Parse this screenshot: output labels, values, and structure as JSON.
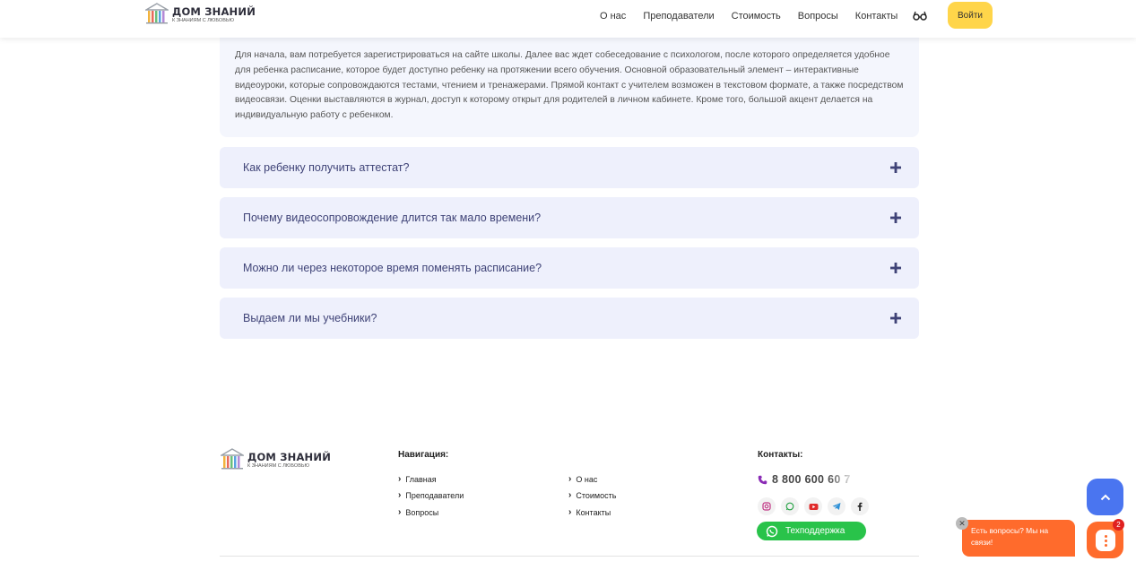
{
  "header": {
    "logo_title": "ДОМ ЗНАНИЙ",
    "logo_subtitle": "К ЗНАНИЯМ С ЛЮБОВЬЮ",
    "nav": [
      "О нас",
      "Преподаватели",
      "Стоимость",
      "Вопросы",
      "Контакты"
    ],
    "login_label": "Войти"
  },
  "faq": {
    "open_answer": "Для начала, вам потребуется зарегистрироваться на сайте школы. Далее вас ждет собеседование с психологом, после которого определяется удобное для ребенка расписание, которое будет доступно ребенку на протяжении всего обучения. Основной образовательный элемент – интерактивные видеоуроки, которые сопровождаются тестами, чтением и тренажерами. Прямой контакт с учителем возможен в текстовом формате, а также посредством видеосвязи. Оценки выставляются в журнал, доступ к которому открыт для родителей в личном кабинете. Кроме того, большой акцент делается на индивидуальную работу с ребенком.",
    "questions": [
      "Как ребенку получить аттестат?",
      "Почему видеосопровождение длится так мало времени?",
      "Можно ли через некоторое время поменять расписание?",
      "Выдаем ли мы учебники?"
    ]
  },
  "footer": {
    "logo_title": "ДОМ ЗНАНИЙ",
    "logo_subtitle": "К ЗНАНИЯМ С ЛЮБОВЬЮ",
    "nav_heading": "Навигация:",
    "nav_col1": [
      "Главная",
      "Преподаватели",
      "Вопросы"
    ],
    "nav_col2": [
      "О нас",
      "Стоимость",
      "Контакты"
    ],
    "contacts_heading": "Контакты:",
    "phone": "8 800 600 60 7",
    "socials": [
      "instagram-icon",
      "whatsapp-icon",
      "youtube-icon",
      "telegram-icon",
      "facebook-icon"
    ],
    "support_label": "Техподдержка"
  },
  "widgets": {
    "chat_prompt": "Есть вопросы? Мы на связи!",
    "chat_badge": "2",
    "close_glyph": "✕"
  },
  "colors": {
    "accent_yellow": "#ffd54a",
    "faq_bg": "#eef0fc",
    "faq_text": "#3f4377",
    "support_green": "#29c34a",
    "chat_orange": "#ff6b2c",
    "scroll_blue": "#4a75f0"
  }
}
